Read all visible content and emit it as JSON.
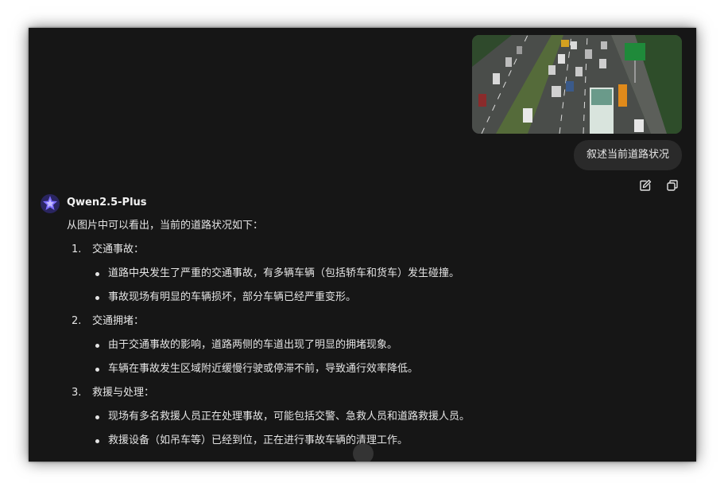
{
  "conversation": {
    "user_message": "叙述当前道路状况",
    "bot_name": "Qwen2.5-Plus",
    "answer": {
      "intro": "从图片中可以看出，当前的道路状况如下：",
      "points": [
        {
          "num": "1.",
          "title": "交通事故：",
          "bullets": [
            "道路中央发生了严重的交通事故，有多辆车辆（包括轿车和货车）发生碰撞。",
            "事故现场有明显的车辆损坏，部分车辆已经严重变形。"
          ]
        },
        {
          "num": "2.",
          "title": "交通拥堵：",
          "bullets": [
            "由于交通事故的影响，道路两侧的车道出现了明显的拥堵现象。",
            "车辆在事故发生区域附近缓慢行驶或停滞不前，导致通行效率降低。"
          ]
        },
        {
          "num": "3.",
          "title": "救援与处理：",
          "bullets": [
            "现场有多名救援人员正在处理事故，可能包括交警、急救人员和道路救援人员。",
            "救援设备（如吊车等）已经到位，正在进行事故车辆的清理工作。"
          ]
        }
      ]
    }
  },
  "icons": {
    "edit": "edit-icon",
    "copy": "copy-icon",
    "avatar": "qwen-logo-icon"
  },
  "colors": {
    "background": "#161616",
    "bubble": "#2a2a2a",
    "text": "#e4e4e4",
    "avatar": "#6b5cf6"
  }
}
